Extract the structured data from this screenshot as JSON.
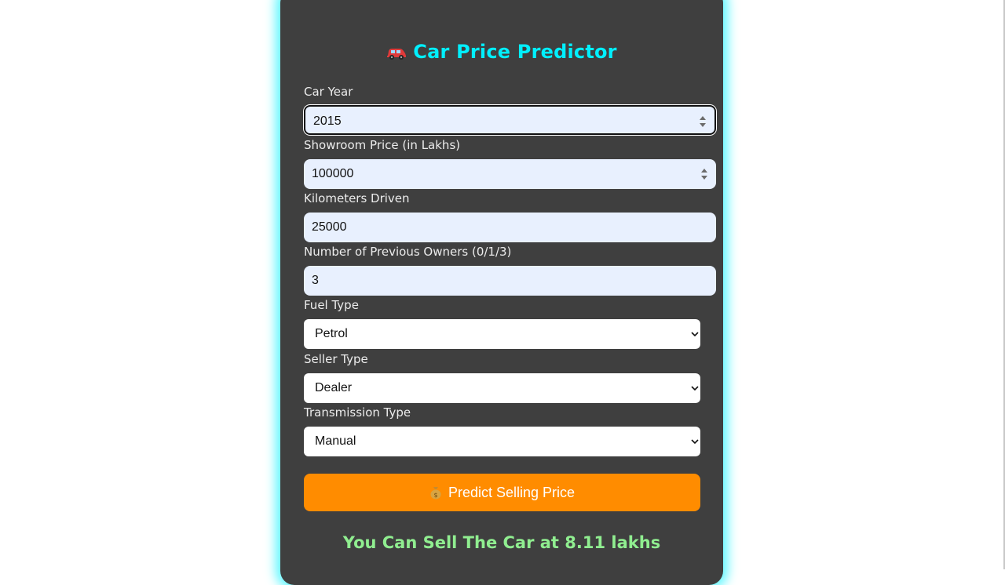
{
  "app": {
    "title": "Car Price Predictor",
    "title_icon": "car-icon",
    "accent_color": "#00f0ff",
    "card_color": "#3f3f3f",
    "glow_color": "#5ff7ff"
  },
  "form": {
    "car_year": {
      "label": "Car Year",
      "value": "2015"
    },
    "showroom_price": {
      "label": "Showroom Price (in Lakhs)",
      "value": "100000"
    },
    "kms_driven": {
      "label": "Kilometers Driven",
      "value": "25000"
    },
    "owners": {
      "label": "Number of Previous Owners (0/1/3)",
      "value": "3"
    },
    "fuel_type": {
      "label": "Fuel Type",
      "selected": "Petrol"
    },
    "seller_type": {
      "label": "Seller Type",
      "selected": "Dealer"
    },
    "transmission": {
      "label": "Transmission Type",
      "selected": "Manual"
    }
  },
  "predict_button": {
    "label": "Predict Selling Price",
    "icon": "money-bag-icon",
    "color": "#ff8c00"
  },
  "result": {
    "text": "You Can Sell The Car at 8.11 lakhs",
    "color": "#90ee90"
  }
}
